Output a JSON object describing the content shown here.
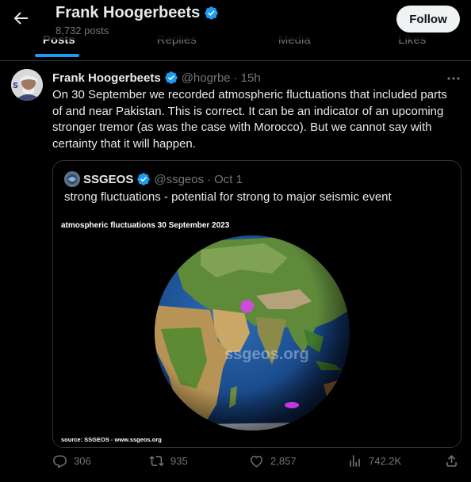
{
  "header": {
    "name": "Frank Hoogerbeets",
    "post_count": "8,732 posts",
    "follow_label": "Follow",
    "tabs": [
      "Posts",
      "Replies",
      "Media",
      "Likes"
    ]
  },
  "post": {
    "author": "Frank Hoogerbeets",
    "handle": "@hogrbe",
    "dot": "·",
    "time": "15h",
    "text": "On 30 September we recorded atmospheric fluctuations that included parts of and near Pakistan. This is correct. It can be an indicator of an upcoming stronger tremor (as was the case with Morocco). But we cannot say with certainty that it will happen."
  },
  "quote": {
    "author": "SSGEOS",
    "handle": "@ssgeos",
    "dot": "·",
    "time": "Oct 1",
    "text": "strong fluctuations - potential for strong to major seismic event",
    "image_title": "atmospheric fluctuations 30 September 2023",
    "image_watermark": "ssgeos.org",
    "image_source": "source: SSGEOS - www.ssgeos.org"
  },
  "actions": {
    "replies": "306",
    "reposts": "935",
    "likes": "2,857",
    "views": "742.2K"
  },
  "colors": {
    "accent": "#1d9bf0",
    "muted": "#71767b",
    "fluctuation": "#e040fb"
  }
}
